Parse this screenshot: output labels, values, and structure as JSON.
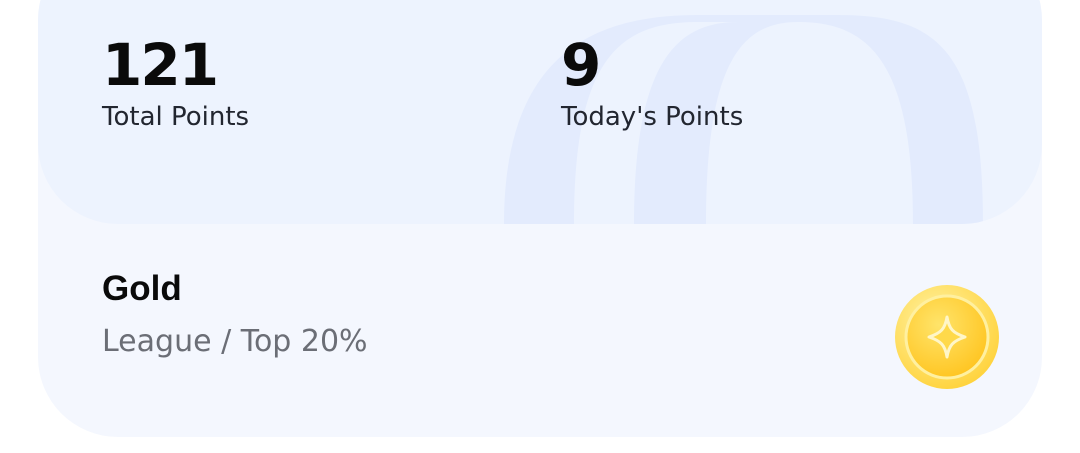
{
  "stats": {
    "total": {
      "value": "121",
      "label": "Total Points"
    },
    "today": {
      "value": "9",
      "label": "Today's Points"
    }
  },
  "league": {
    "name": "Gold",
    "subtitle": "League / Top 20%",
    "badge_icon": "gold-coin-sparkle-icon"
  },
  "colors": {
    "card_bg": "#f4f7fe",
    "stats_bg": "#edf3fe",
    "arch_decoration": "#e3ebfd",
    "gold_light": "#ffe98a",
    "gold_dark": "#ffc928"
  }
}
